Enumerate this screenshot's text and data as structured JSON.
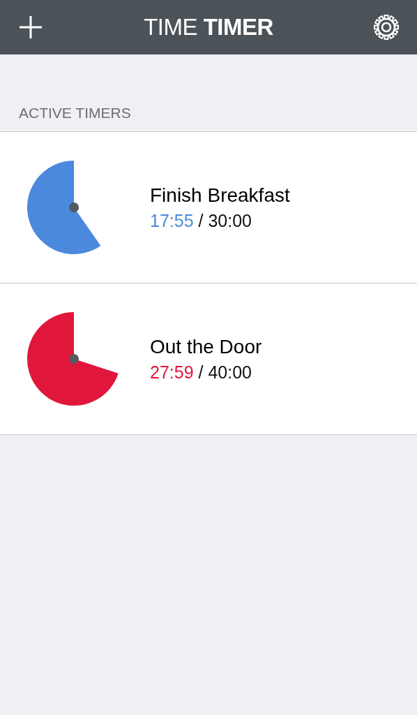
{
  "header": {
    "title": "TIME **TIMER**"
  },
  "section_title": "ACTIVE TIMERS",
  "timers": [
    {
      "name": "Finish Breakfast",
      "remaining": "17:55",
      "total": "/ 30:00",
      "color": "#4a89dc"
    },
    {
      "name": "Out the Door",
      "remaining": "27:59",
      "total": "/ 40:00",
      "color": "#e0173a"
    }
  ]
}
